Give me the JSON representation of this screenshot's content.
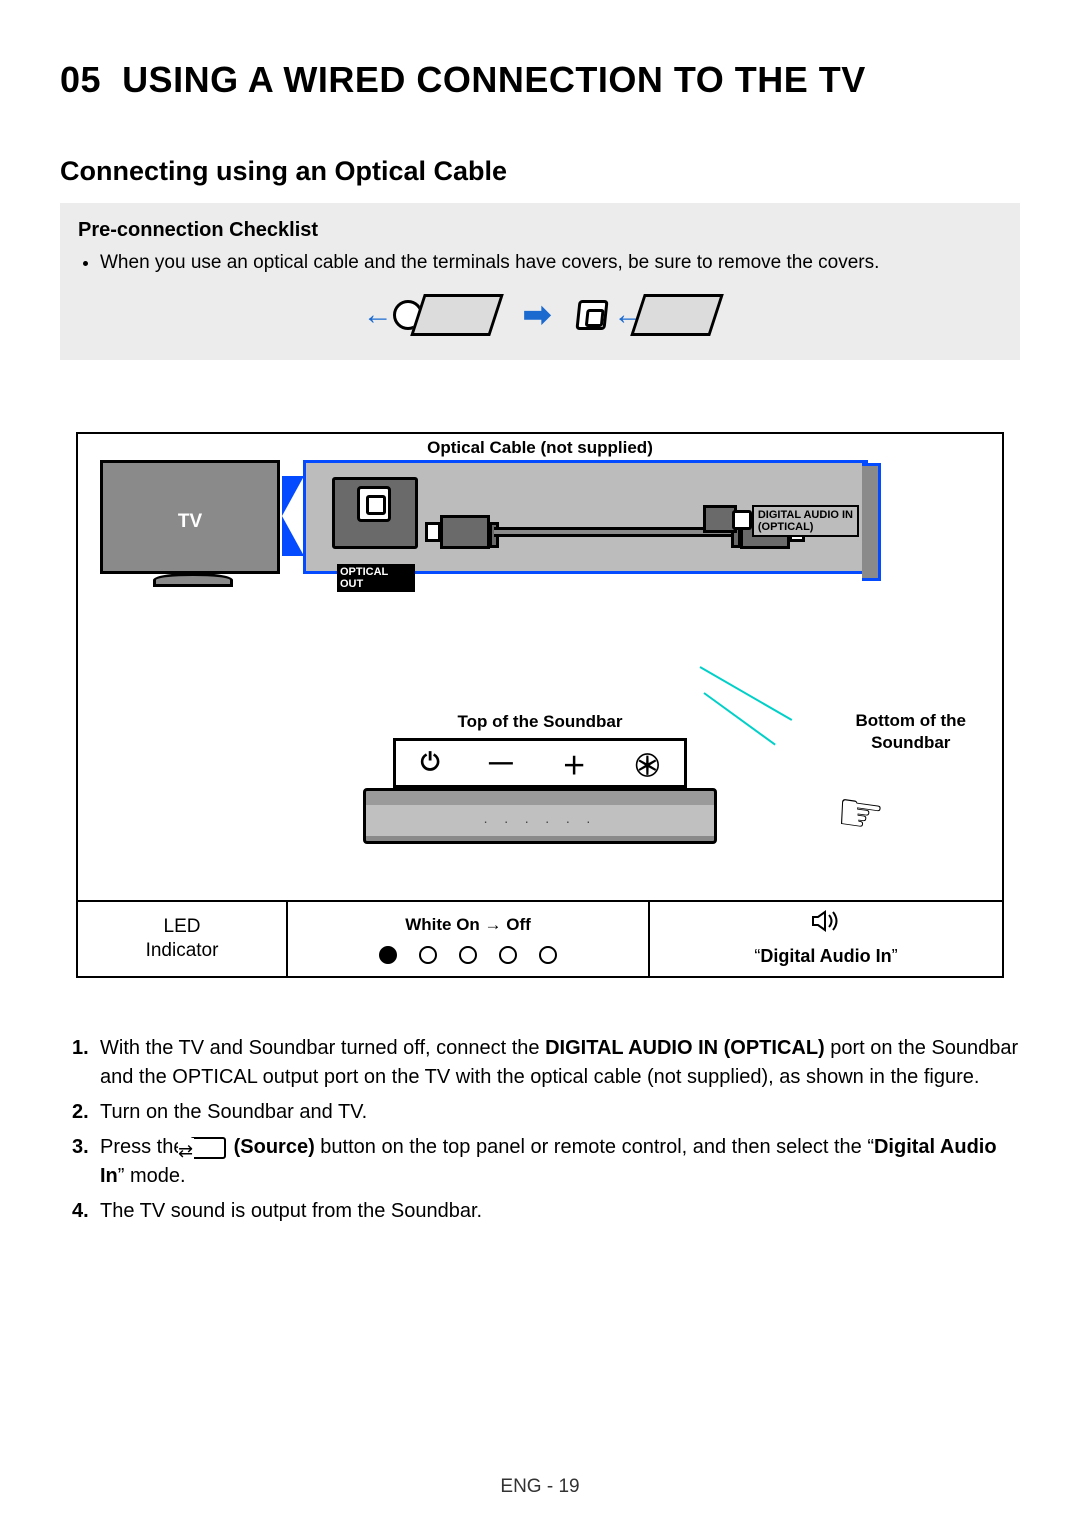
{
  "page": {
    "section_number": "05",
    "section_title": "USING A WIRED CONNECTION TO THE TV"
  },
  "subsection": {
    "title": "Connecting using an Optical Cable"
  },
  "checklist": {
    "title": "Pre-connection Checklist",
    "item1": "When you use an optical cable and the terminals have covers, be sure to remove the covers."
  },
  "diagram": {
    "optical_cable_label": "Optical Cable (not supplied)",
    "tv_label": "TV",
    "optical_out_label": "OPTICAL OUT",
    "digital_audio_in_label_line1": "DIGITAL AUDIO IN",
    "digital_audio_in_label_line2": "(OPTICAL)",
    "top_soundbar_label": "Top of the Soundbar",
    "bottom_soundbar_label_line1": "Bottom of the",
    "bottom_soundbar_label_line2": "Soundbar",
    "led_cell_line1": "LED",
    "led_cell_line2": "Indicator",
    "white_cell_label": "White On → Off",
    "audio_cell_label": "Digital Audio In"
  },
  "steps": {
    "s1_pre": "With the TV and Soundbar turned off, connect the ",
    "s1_bold": "DIGITAL AUDIO IN (OPTICAL)",
    "s1_post": " port on the Soundbar and the OPTICAL output port on the TV with the optical cable (not supplied), as shown in the figure.",
    "s2": "Turn on the Soundbar and TV.",
    "s3_pre": "Press the ",
    "s3_source": " (Source)",
    "s3_mid": " button on the top panel or remote control, and then select the “",
    "s3_mode": "Digital Audio In",
    "s3_post": "” mode.",
    "s4": "The TV sound is output from the Soundbar."
  },
  "footer": {
    "text": "ENG - 19"
  }
}
